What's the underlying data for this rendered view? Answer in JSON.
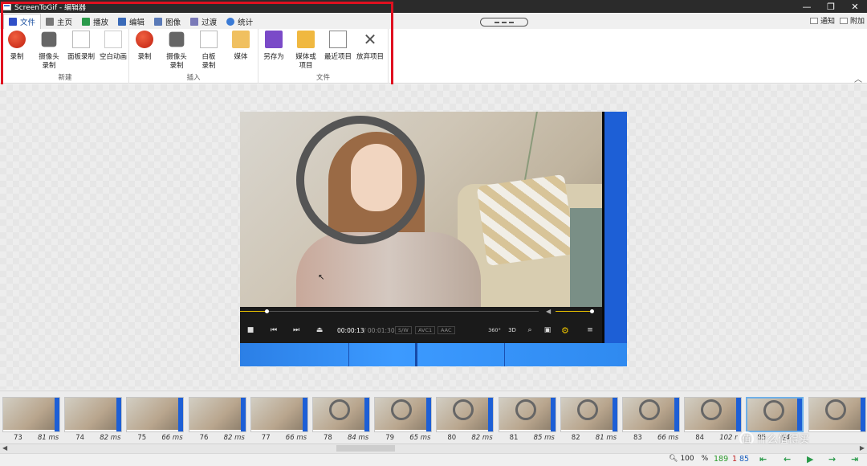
{
  "window": {
    "title": "ScreenToGif - 编辑器",
    "minimize": "—",
    "restore": "❐",
    "close": "✕"
  },
  "tabs": [
    {
      "label": "文件",
      "icon": "save-icon",
      "color": "#3050c8"
    },
    {
      "label": "主页",
      "icon": "home-icon",
      "color": "#777777"
    },
    {
      "label": "播放",
      "icon": "play-icon",
      "color": "#2a9a4a"
    },
    {
      "label": "编辑",
      "icon": "pencil-icon",
      "color": "#3a6ab8"
    },
    {
      "label": "图像",
      "icon": "image-icon",
      "color": "#5a7ab8"
    },
    {
      "label": "过渡",
      "icon": "transition-icon",
      "color": "#7a7ab8"
    },
    {
      "label": "统计",
      "icon": "info-icon",
      "color": "#3a7ad5"
    }
  ],
  "notify_label": "通知",
  "attach_label": "附加",
  "ribbon": {
    "groups": [
      {
        "label": "新建",
        "buttons": [
          {
            "label": "录制",
            "icon": "record-icon"
          },
          {
            "label": "摄像头\n录制",
            "icon": "webcam-icon"
          },
          {
            "label": "面板录制",
            "icon": "board-icon"
          },
          {
            "label": "空白动画",
            "icon": "blank-icon"
          }
        ]
      },
      {
        "label": "插入",
        "buttons": [
          {
            "label": "录制",
            "icon": "record-insert-icon"
          },
          {
            "label": "摄像头\n录制",
            "icon": "webcam-insert-icon"
          },
          {
            "label": "白板\n录制",
            "icon": "board-insert-icon"
          },
          {
            "label": "媒体",
            "icon": "folder-icon"
          }
        ]
      },
      {
        "label": "文件",
        "buttons": [
          {
            "label": "另存为",
            "icon": "floppy-icon"
          },
          {
            "label": "媒体或\n项目",
            "icon": "folder-open-icon"
          },
          {
            "label": "最近项目",
            "icon": "recent-icon"
          },
          {
            "label": "放弃项目",
            "icon": "discard-icon"
          }
        ]
      }
    ]
  },
  "player": {
    "time_current": "00:00:13",
    "time_total": "/ 00:01:30",
    "badges": [
      "S/W",
      "AVC1",
      "AAC"
    ],
    "labels": [
      "360°",
      "3D"
    ],
    "progress": 0.09,
    "volume": 0.93
  },
  "filmstrip": [
    {
      "num": "73",
      "ms": "81 ms"
    },
    {
      "num": "74",
      "ms": "82 ms"
    },
    {
      "num": "75",
      "ms": "66 ms"
    },
    {
      "num": "76",
      "ms": "82 ms"
    },
    {
      "num": "77",
      "ms": "66 ms"
    },
    {
      "num": "78",
      "ms": "84 ms"
    },
    {
      "num": "79",
      "ms": "65 ms"
    },
    {
      "num": "80",
      "ms": "82 ms"
    },
    {
      "num": "81",
      "ms": "85 ms"
    },
    {
      "num": "82",
      "ms": "81 ms"
    },
    {
      "num": "83",
      "ms": "66 ms"
    },
    {
      "num": "84",
      "ms": "102 r"
    },
    {
      "num": "85",
      "ms": "64"
    },
    {
      "num": "",
      "ms": ""
    }
  ],
  "selected_index": 12,
  "status": {
    "zoom": "100",
    "percent": "%",
    "total": "189",
    "selected": "1",
    "current": "85"
  },
  "watermark": {
    "glyph": "值",
    "text": "什么值得买"
  },
  "colors": {
    "accent": "#1a4fa0",
    "highlight": "#e01020",
    "total": "#2a9a2a",
    "selected": "#c02020",
    "current": "#1a5fbf"
  }
}
